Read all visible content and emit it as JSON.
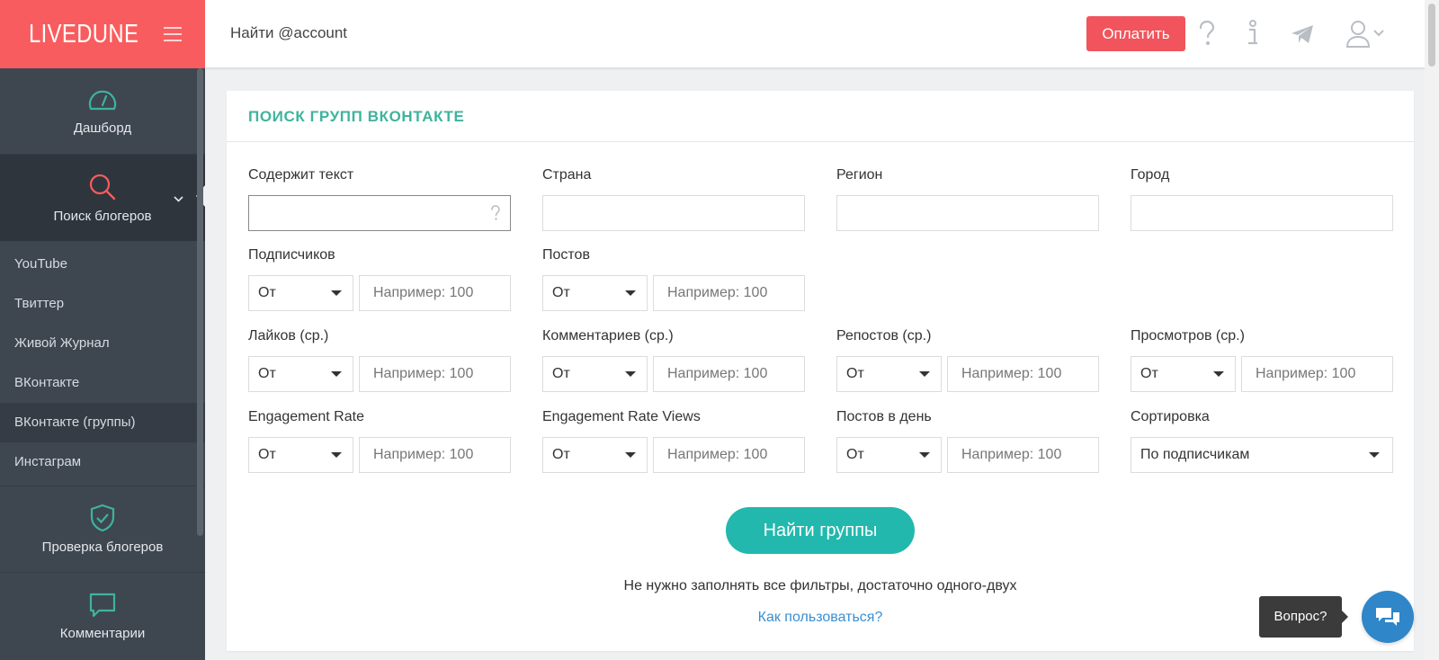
{
  "brand": {
    "name": "LIVEDUNE"
  },
  "sidebar": {
    "dashboard": {
      "label": "Дашборд",
      "icon": "dashboard-gauge-icon"
    },
    "search": {
      "label": "Поиск блогеров",
      "icon": "search-icon"
    },
    "subitems": [
      {
        "label": "YouTube"
      },
      {
        "label": "Твиттер"
      },
      {
        "label": "Живой Журнал"
      },
      {
        "label": "ВКонтакте"
      },
      {
        "label": "ВКонтакте (группы)",
        "active": true
      },
      {
        "label": "Инстаграм"
      }
    ],
    "check": {
      "label": "Проверка блогеров",
      "icon": "shield-check-icon"
    },
    "comments": {
      "label": "Комментарии",
      "icon": "chat-bubble-icon"
    }
  },
  "header": {
    "search_placeholder": "Найти @account",
    "pay_label": "Оплатить",
    "icons": [
      "question-icon",
      "info-icon",
      "telegram-icon",
      "user-icon"
    ]
  },
  "card": {
    "title": "ПОИСК ГРУПП ВКОНТАКТЕ",
    "fields": {
      "text": {
        "label": "Содержит текст",
        "value": ""
      },
      "country": {
        "label": "Страна",
        "value": ""
      },
      "region": {
        "label": "Регион",
        "value": ""
      },
      "city": {
        "label": "Город",
        "value": ""
      },
      "subscribers": {
        "label": "Подписчиков",
        "op": "От",
        "placeholder": "Например: 100"
      },
      "posts": {
        "label": "Постов",
        "op": "От",
        "placeholder": "Например: 100"
      },
      "likes": {
        "label": "Лайков (ср.)",
        "op": "От",
        "placeholder": "Например: 100"
      },
      "comments": {
        "label": "Комментариев (ср.)",
        "op": "От",
        "placeholder": "Например: 100"
      },
      "reposts": {
        "label": "Репостов (ср.)",
        "op": "От",
        "placeholder": "Например: 100"
      },
      "views": {
        "label": "Просмотров (ср.)",
        "op": "От",
        "placeholder": "Например: 100"
      },
      "er": {
        "label": "Engagement Rate",
        "op": "От",
        "placeholder": "Например: 100"
      },
      "erv": {
        "label": "Engagement Rate Views",
        "op": "От",
        "placeholder": "Например: 100"
      },
      "posts_per_day": {
        "label": "Постов в день",
        "op": "От",
        "placeholder": "Например: 100"
      },
      "sort": {
        "label": "Сортировка",
        "value": "По подписчикам"
      }
    },
    "submit_label": "Найти группы",
    "hint": "Не нужно заполнять все фильтры, достаточно одного-двух",
    "howto": "Как пользоваться?"
  },
  "chat": {
    "tooltip": "Вопрос?"
  },
  "colors": {
    "brand": "#f95c5e",
    "sidebar": "#3e4650",
    "accent": "#22b8ad",
    "title": "#3fb39d",
    "link": "#3a8fd1",
    "pay": "#f1545d"
  }
}
